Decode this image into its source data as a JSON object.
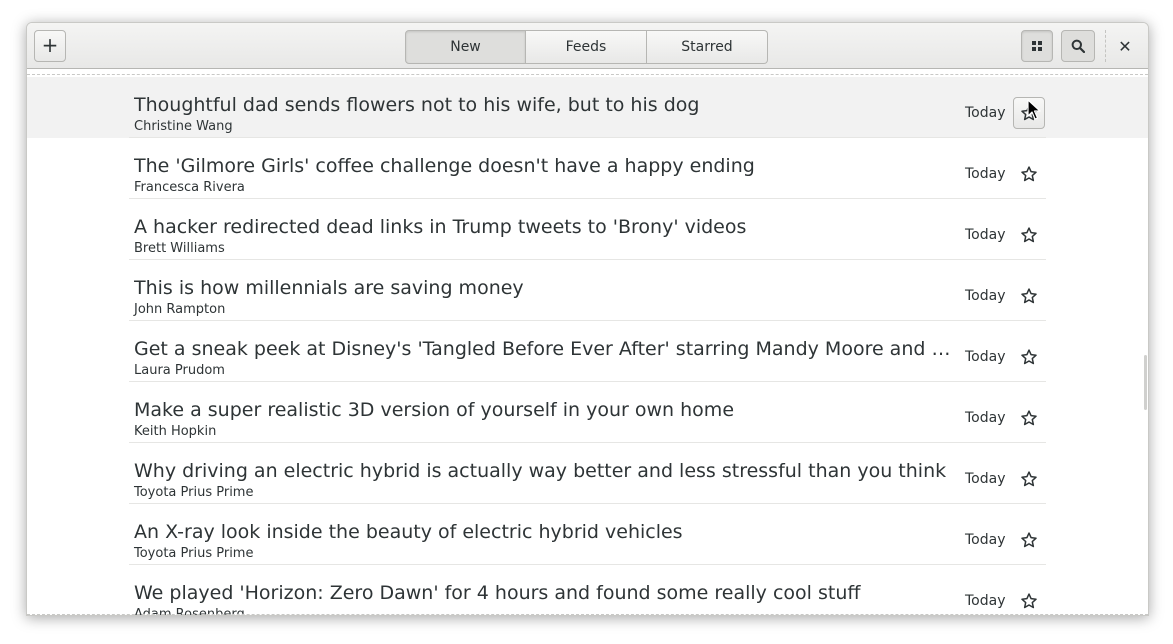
{
  "header": {
    "add_button": "+",
    "tabs": [
      {
        "label": "New",
        "active": true
      },
      {
        "label": "Feeds",
        "active": false
      },
      {
        "label": "Starred",
        "active": false
      }
    ],
    "close_glyph": "✕",
    "icons": {
      "add": "plus-icon",
      "select": "grid-icon",
      "search": "search-icon",
      "close": "close-icon"
    }
  },
  "articles": [
    {
      "title": "Thoughtful dad sends flowers not to his wife, but to his dog",
      "author": "Christine Wang",
      "date": "Today",
      "starred": false
    },
    {
      "title": "The 'Gilmore Girls' coffee challenge doesn't have a happy ending",
      "author": "Francesca Rivera",
      "date": "Today",
      "starred": false
    },
    {
      "title": "A hacker redirected dead links in Trump tweets to 'Brony' videos",
      "author": "Brett Williams",
      "date": "Today",
      "starred": false
    },
    {
      "title": "This is how millennials are saving money",
      "author": "John Rampton",
      "date": "Today",
      "starred": false
    },
    {
      "title": " Get a sneak peek at Disney's 'Tangled Before Ever After' starring Mandy Moore and Zac…",
      "author": "Laura Prudom",
      "date": "Today",
      "starred": false
    },
    {
      "title": "Make a super realistic 3D version of yourself in your own home",
      "author": "Keith Hopkin",
      "date": "Today",
      "starred": false
    },
    {
      "title": "Why driving an electric hybrid is actually way better and less stressful than you think",
      "author": "Toyota Prius Prime",
      "date": "Today",
      "starred": false
    },
    {
      "title": "An X-ray look inside the beauty of electric hybrid vehicles",
      "author": "Toyota Prius Prime",
      "date": "Today",
      "starred": false
    },
    {
      "title": "We played 'Horizon: Zero Dawn' for 4 hours and found some really cool stuff",
      "author": "Adam Rosenberg",
      "date": "Today",
      "starred": false
    }
  ],
  "colors": {
    "text": "#2e3436",
    "hover_row": "#f2f2f2"
  }
}
